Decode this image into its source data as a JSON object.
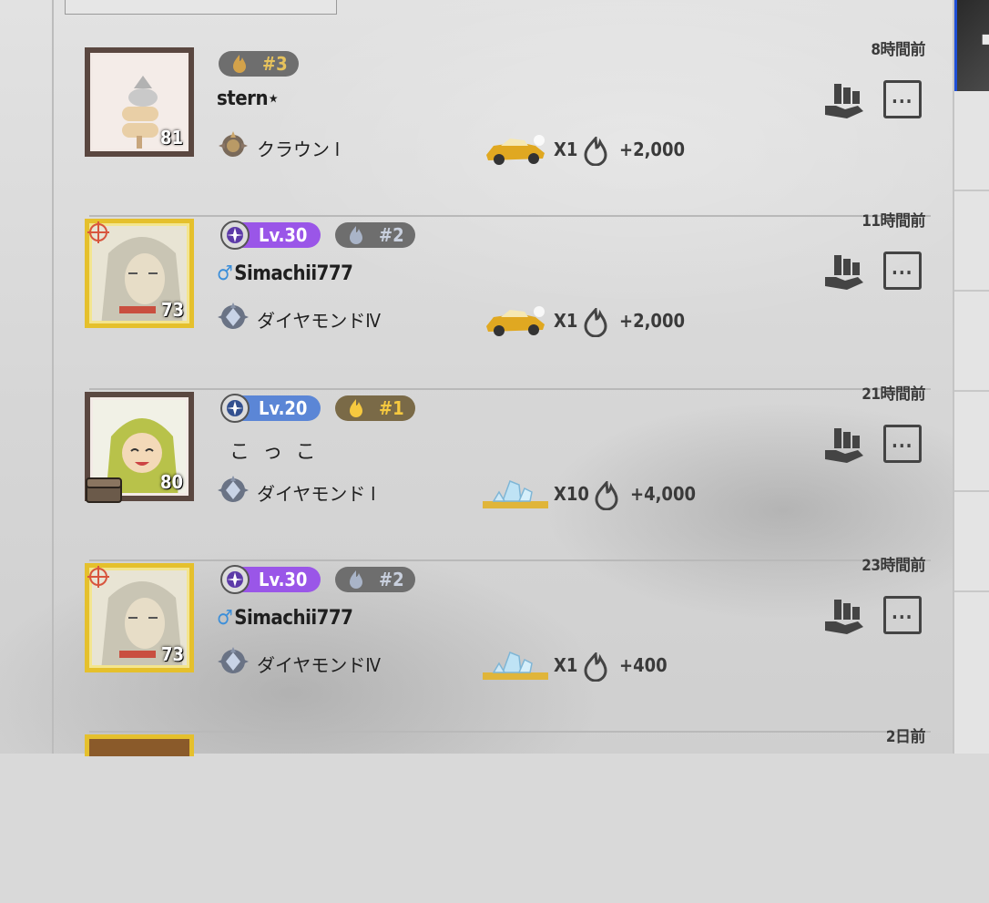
{
  "feed": [
    {
      "time": "8時間前",
      "level_label": "",
      "fire_rank": "#3",
      "name": "stern⋆",
      "gender": "",
      "rank_title": "クラウン Ⅰ",
      "avatar_level": "81",
      "reward_qty": "X1",
      "reward_points": "+2,000"
    },
    {
      "time": "11時間前",
      "level_label": "Lv.30",
      "fire_rank": "#2",
      "name": "Simachii777",
      "gender": "♂",
      "rank_title": "ダイヤモンドⅣ",
      "avatar_level": "73",
      "reward_qty": "X1",
      "reward_points": "+2,000"
    },
    {
      "time": "21時間前",
      "level_label": "Lv.20",
      "fire_rank": "#1",
      "name": "こ っ こ",
      "gender": "",
      "rank_title": "ダイヤモンド Ⅰ",
      "avatar_level": "80",
      "reward_qty": "X10",
      "reward_points": "+4,000"
    },
    {
      "time": "23時間前",
      "level_label": "Lv.30",
      "fire_rank": "#2",
      "name": "Simachii777",
      "gender": "♂",
      "rank_title": "ダイヤモンドⅣ",
      "avatar_level": "73",
      "reward_qty": "X1",
      "reward_points": "+400"
    },
    {
      "time": "2日前"
    }
  ],
  "icons": {
    "fire": "fire-icon",
    "car": "yellow-car-icon",
    "crystal": "crystal-icon",
    "hand": "hand-icon",
    "menu": "menu-icon"
  },
  "colors": {
    "level_purple": "#9a56e8",
    "level_blue": "#5b86d6",
    "gold_frame": "#e5c02c",
    "fire_gray": "#6e6e6e",
    "fire_gold": "#f6c93f"
  }
}
